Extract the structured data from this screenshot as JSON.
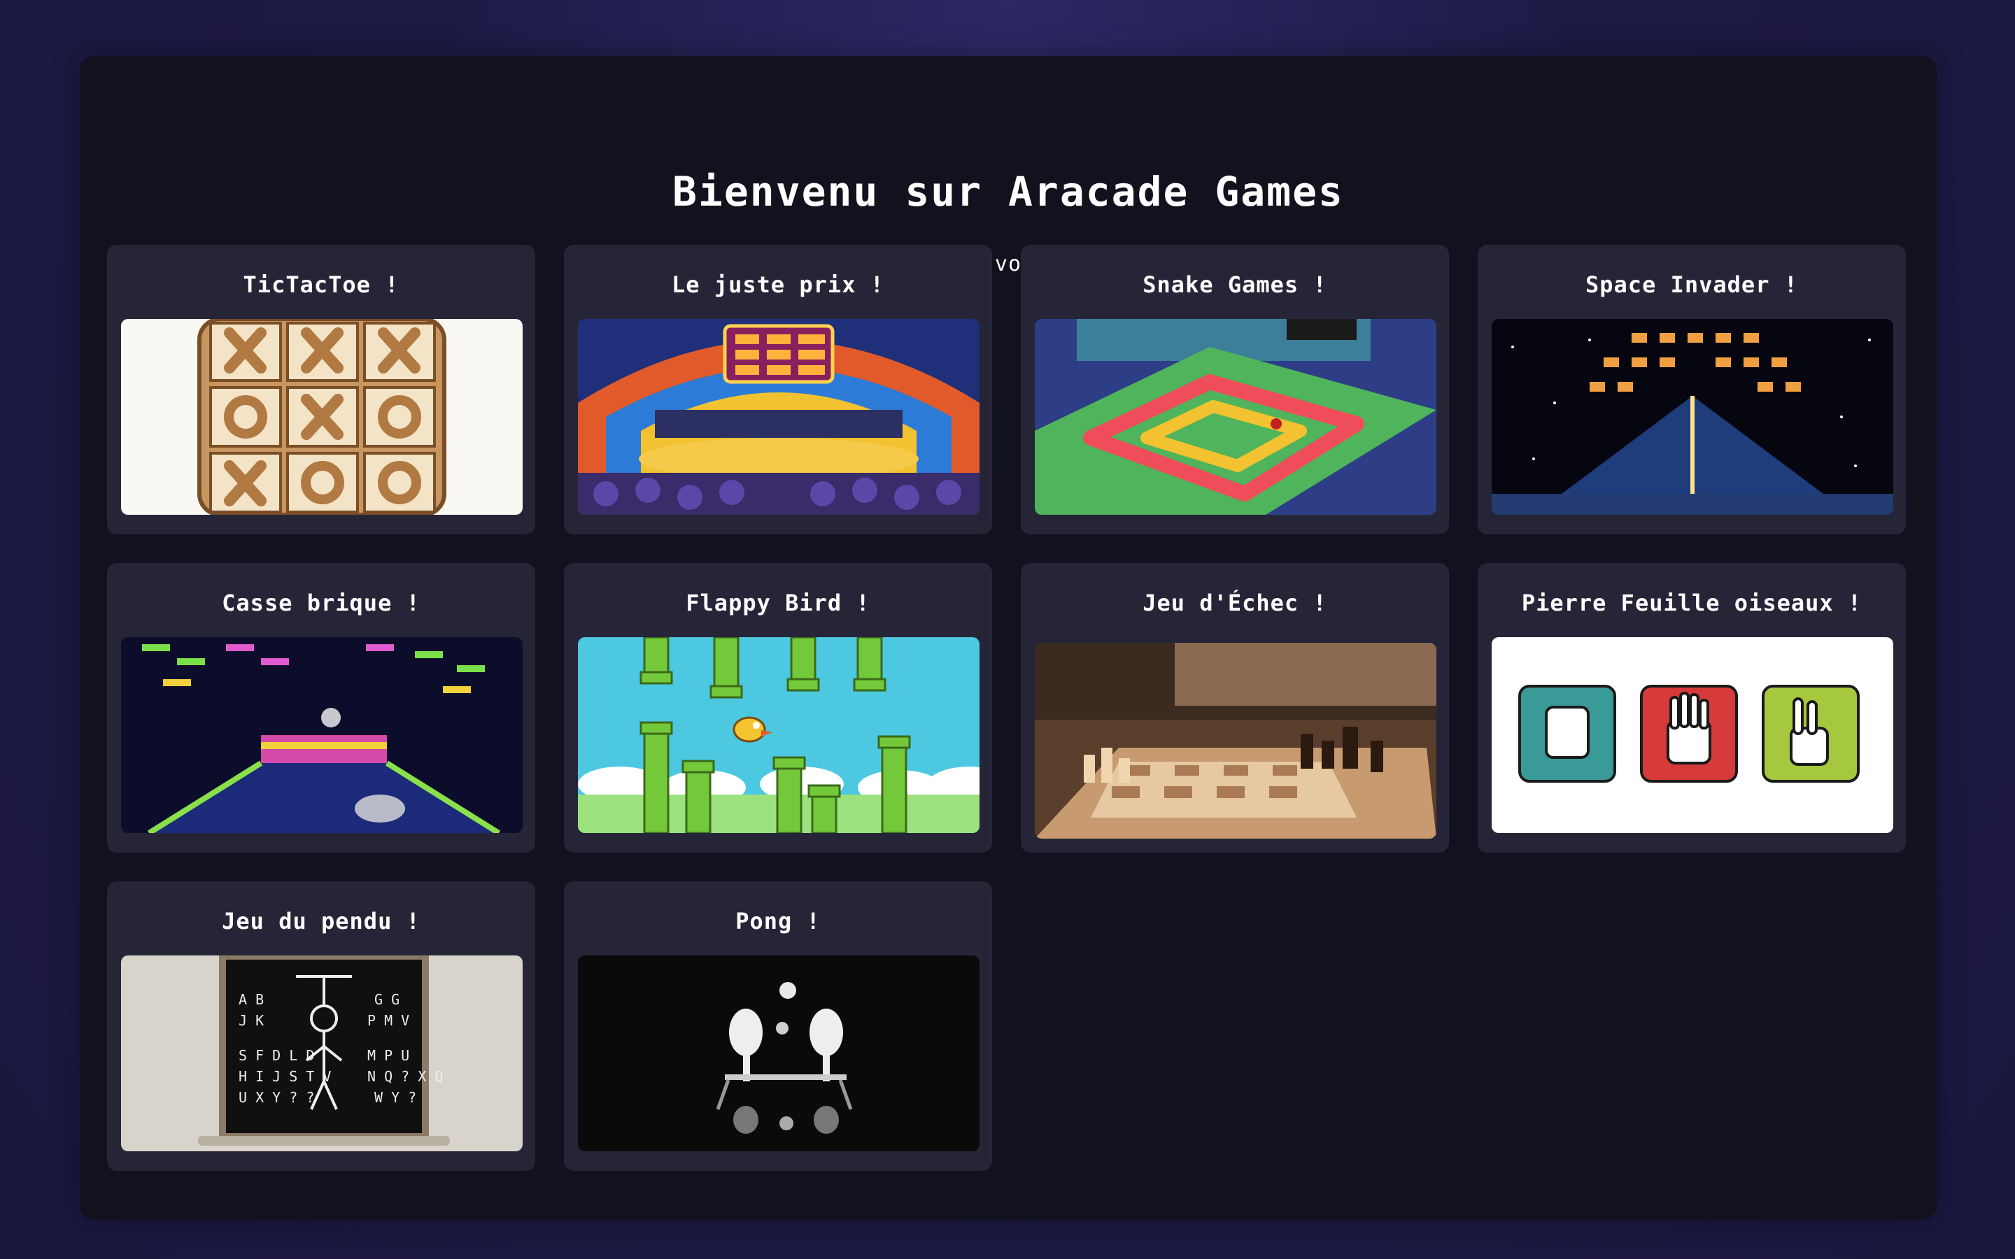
{
  "header": {
    "title": "Bienvenu sur Aracade Games",
    "subtitle": "Choisissez votre jeux :)"
  },
  "games": [
    {
      "title": "TicTacToe !",
      "image": "tictactoe-board-image"
    },
    {
      "title": "Le juste prix !",
      "image": "game-show-stage-image"
    },
    {
      "title": "Snake Games !",
      "image": "snake-grid-image"
    },
    {
      "title": "Space Invader !",
      "image": "space-invaders-image"
    },
    {
      "title": "Casse brique !",
      "image": "brick-breaker-image"
    },
    {
      "title": "Flappy Bird !",
      "image": "flappy-bird-pipes-image"
    },
    {
      "title": "Jeu d'Échec !",
      "image": "chess-board-image"
    },
    {
      "title": "Pierre Feuille oiseaux !",
      "image": "rock-paper-scissors-hands-image"
    },
    {
      "title": "Jeu du pendu !",
      "image": "hangman-chalkboard-image"
    },
    {
      "title": "Pong !",
      "image": "pong-paddles-image"
    }
  ],
  "colors": {
    "background": "#1d1a45",
    "panel": "#12121f",
    "card": "#262538",
    "text": "#ffffff"
  }
}
